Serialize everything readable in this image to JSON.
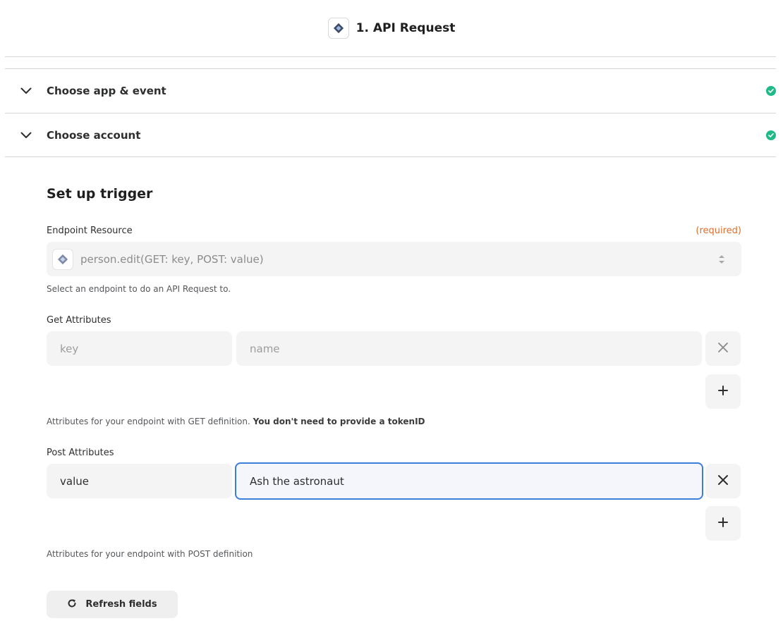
{
  "header": {
    "title": "1. API Request"
  },
  "sections": [
    {
      "label": "Choose app & event",
      "status": "complete"
    },
    {
      "label": "Choose account",
      "status": "complete"
    }
  ],
  "setup": {
    "title": "Set up trigger",
    "endpoint": {
      "label": "Endpoint Resource",
      "required": "(required)",
      "value": "person.edit(GET: key, POST: value)",
      "help": "Select an endpoint to do an API Request to."
    },
    "get_attributes": {
      "label": "Get Attributes",
      "key_placeholder": "key",
      "value_placeholder": "name",
      "help_prefix": "Attributes for your endpoint with GET definition. ",
      "help_bold": "You don't need to provide a tokenID"
    },
    "post_attributes": {
      "label": "Post Attributes",
      "key": "value",
      "value": "Ash the astronaut",
      "help": "Attributes for your endpoint with POST definition"
    },
    "refresh_label": "Refresh fields"
  },
  "colors": {
    "check": "#1fba87",
    "required": "#e06e2b",
    "focus": "#3b7fd9"
  }
}
